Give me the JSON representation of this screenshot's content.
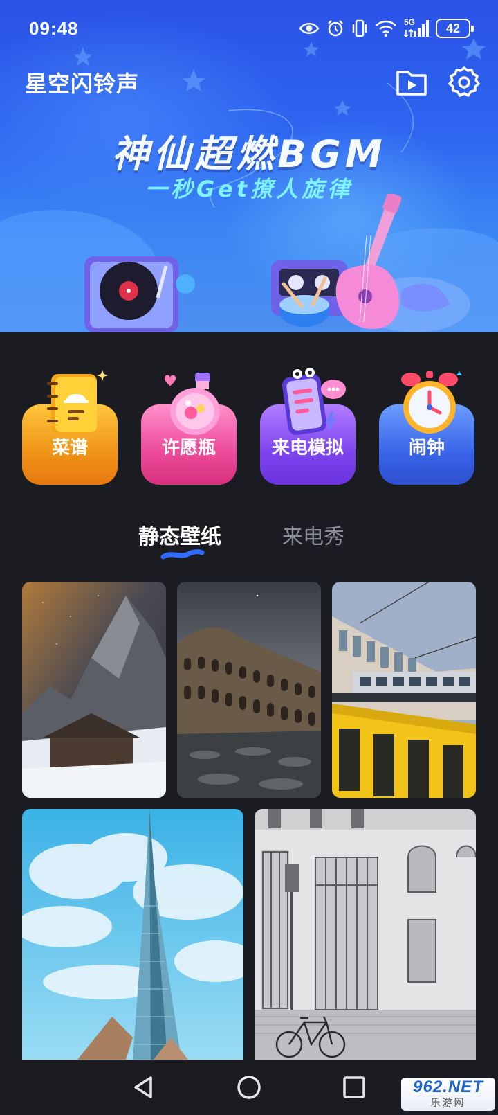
{
  "status_bar": {
    "time": "09:48",
    "network": "5G",
    "battery": "42",
    "icons": [
      "eye-icon",
      "alarm-icon",
      "vibrate-icon",
      "wifi-icon",
      "signal-icon",
      "battery-icon"
    ]
  },
  "header": {
    "title": "星空闪铃声",
    "actions": [
      "video-folder-icon",
      "gear-icon"
    ]
  },
  "banner": {
    "headline": "神仙超燃BGM",
    "subtitle": "一秒Get撩人旋律"
  },
  "shortcuts": [
    {
      "label": "菜谱",
      "icon": "recipe-book-icon",
      "color": "#f39a1e"
    },
    {
      "label": "许愿瓶",
      "icon": "wish-bottle-icon",
      "color": "#ef4f9a"
    },
    {
      "label": "来电模拟",
      "icon": "phone-call-icon",
      "color": "#8a4ff0"
    },
    {
      "label": "闹钟",
      "icon": "alarm-clock-icon",
      "color": "#3b6ff0"
    }
  ],
  "tabs": {
    "items": [
      "静态壁纸",
      "来电秀"
    ],
    "active_index": 0,
    "accent": "#2f6bff"
  },
  "wallpapers": [
    "snowy-mountain-cabin",
    "colosseum",
    "train-bridge",
    "glass-spire-tower",
    "white-building-bicycle"
  ],
  "navbar": {
    "buttons": [
      "back-icon",
      "home-icon",
      "recents-icon"
    ]
  },
  "watermark": {
    "top": "962.NET",
    "bottom": "乐游网"
  }
}
